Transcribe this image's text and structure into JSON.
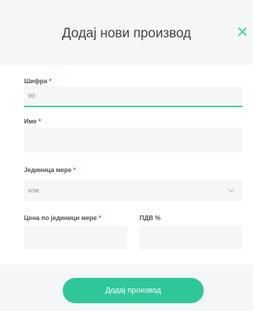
{
  "modal": {
    "title": "Додај нови производ",
    "close_icon": "close-icon",
    "accent_color": "#2fc79a"
  },
  "form": {
    "code": {
      "label": "Шифра",
      "required_mark": "*",
      "value": "90"
    },
    "name": {
      "label": "Име",
      "required_mark": "*",
      "value": ""
    },
    "unit": {
      "label": "Јединица мере",
      "required_mark": "*",
      "value": "ком",
      "icon": "chevron-down-icon"
    },
    "price": {
      "label": "Цена по јединици мере",
      "required_mark": "*",
      "value": ""
    },
    "vat": {
      "label": "ПДВ %",
      "value": ""
    }
  },
  "footer": {
    "submit_label": "Додај производ"
  }
}
